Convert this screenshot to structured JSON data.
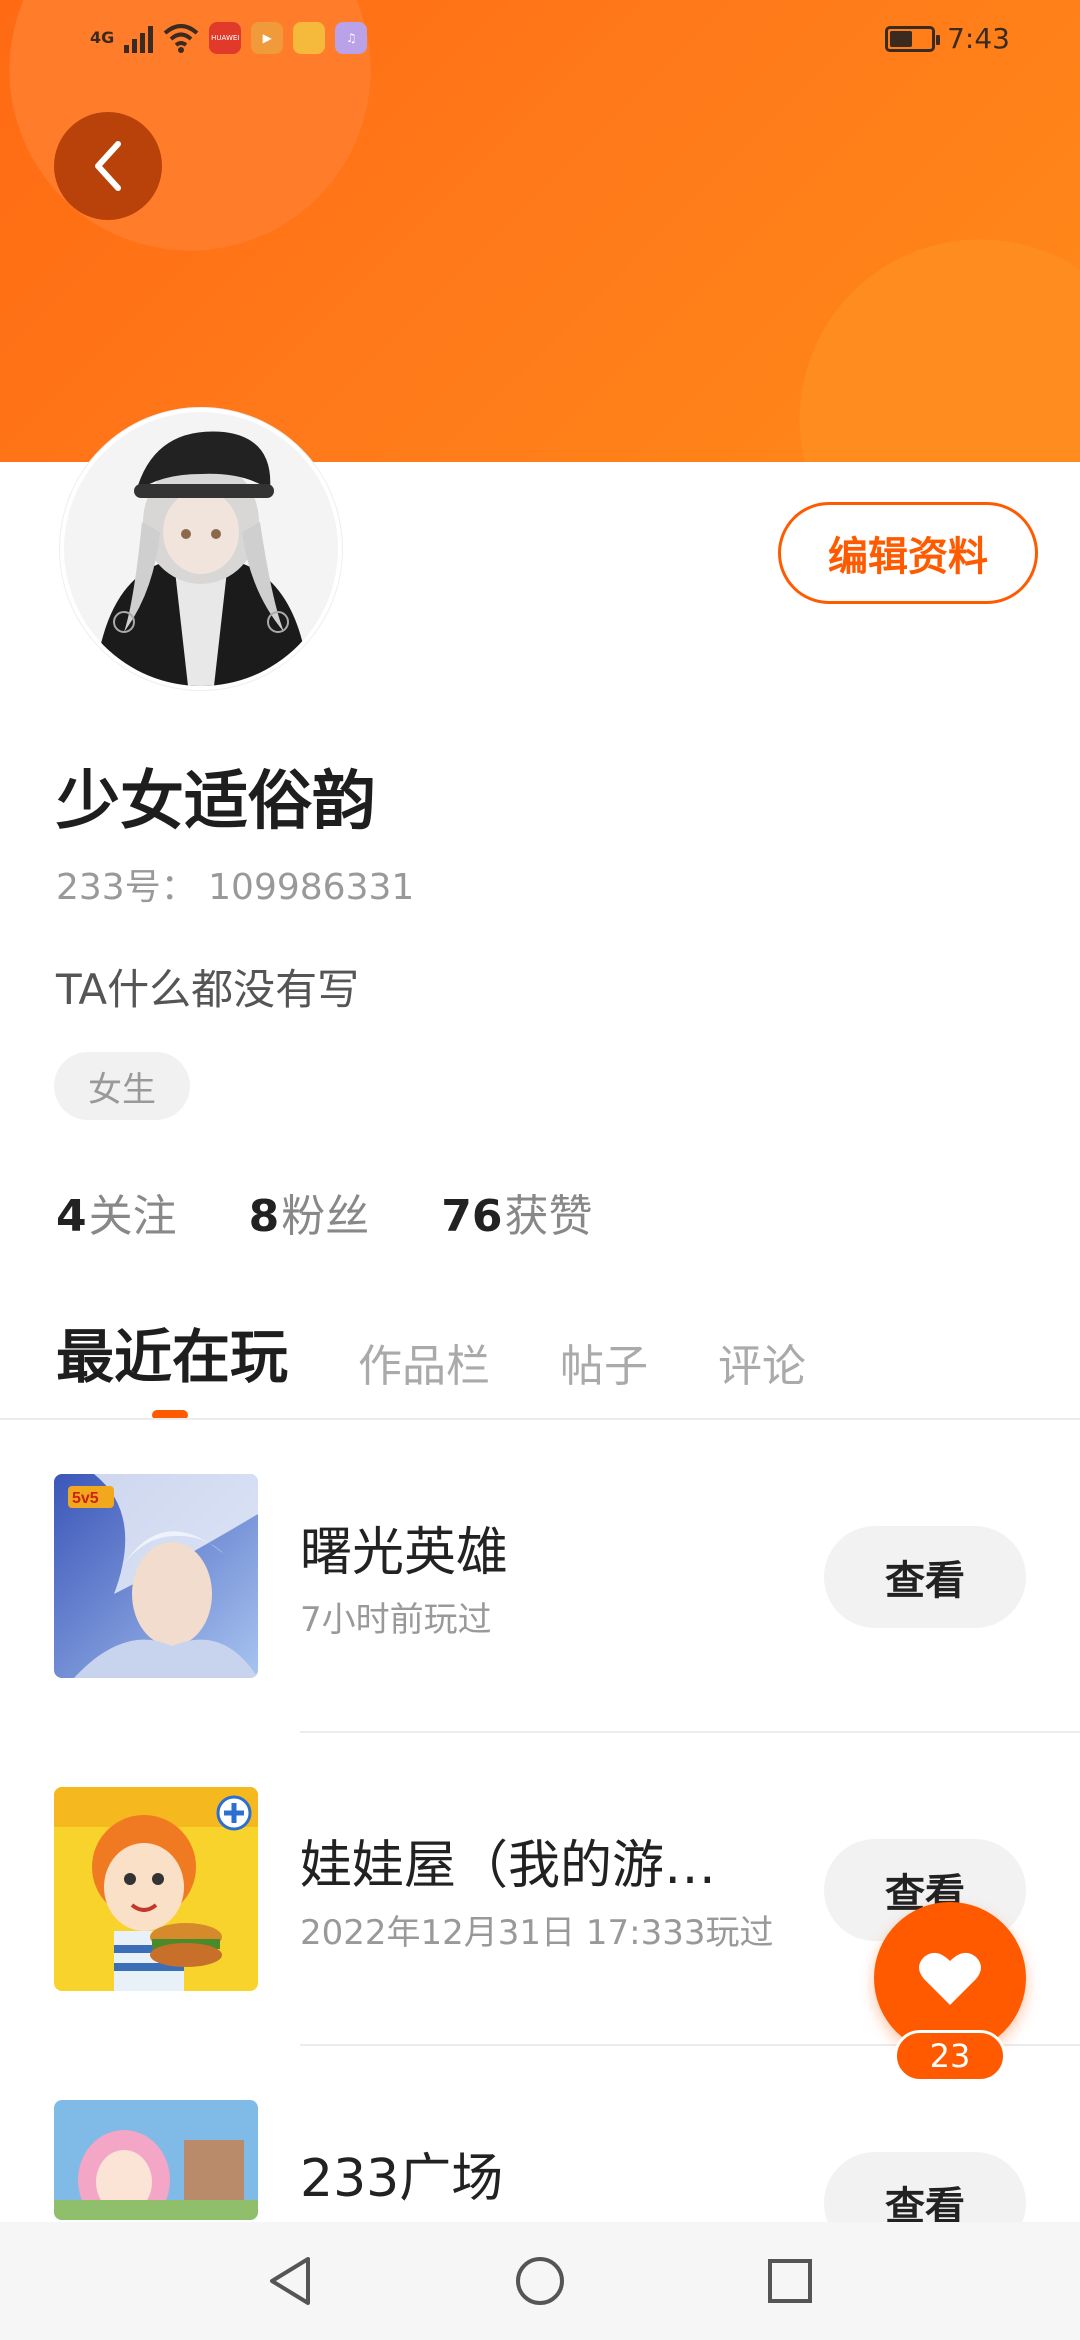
{
  "status_bar": {
    "network": "4G",
    "time": "7:43",
    "battery_percent": 55,
    "apps": [
      {
        "icon": "huawei-app-icon",
        "label": "HUAWEI",
        "color": "#e23a2a"
      },
      {
        "icon": "video-app-icon",
        "label": "▶",
        "color": "#f09a3b"
      },
      {
        "icon": "photo-app-icon",
        "label": "",
        "color": "#f5b93b"
      },
      {
        "icon": "music-app-icon",
        "label": "♫",
        "color": "#b9a2e8"
      }
    ]
  },
  "profile": {
    "edit_label": "编辑资料",
    "username": "少女适俗韵",
    "user_id": "233号：  109986331",
    "bio": "TA什么都没有写",
    "gender": "女生",
    "stats": [
      {
        "num": "4",
        "label": "关注"
      },
      {
        "num": "8",
        "label": "粉丝"
      },
      {
        "num": "76",
        "label": "获赞"
      }
    ]
  },
  "tabs": [
    {
      "label": "最近在玩",
      "active": true
    },
    {
      "label": "作品栏",
      "active": false
    },
    {
      "label": "帖子",
      "active": false
    },
    {
      "label": "评论",
      "active": false
    }
  ],
  "games": [
    {
      "name": "曙光英雄",
      "meta": "7小时前玩过",
      "button": "查看"
    },
    {
      "name": "娃娃屋（我的游…",
      "meta": "2022年12月31日 17:333玩过",
      "button": "查看"
    },
    {
      "name": "233广场",
      "meta": "",
      "button": "查看"
    }
  ],
  "like": {
    "count": "23"
  },
  "colors": {
    "accent": "#ff5a00",
    "banner": "#ff7a1a"
  }
}
